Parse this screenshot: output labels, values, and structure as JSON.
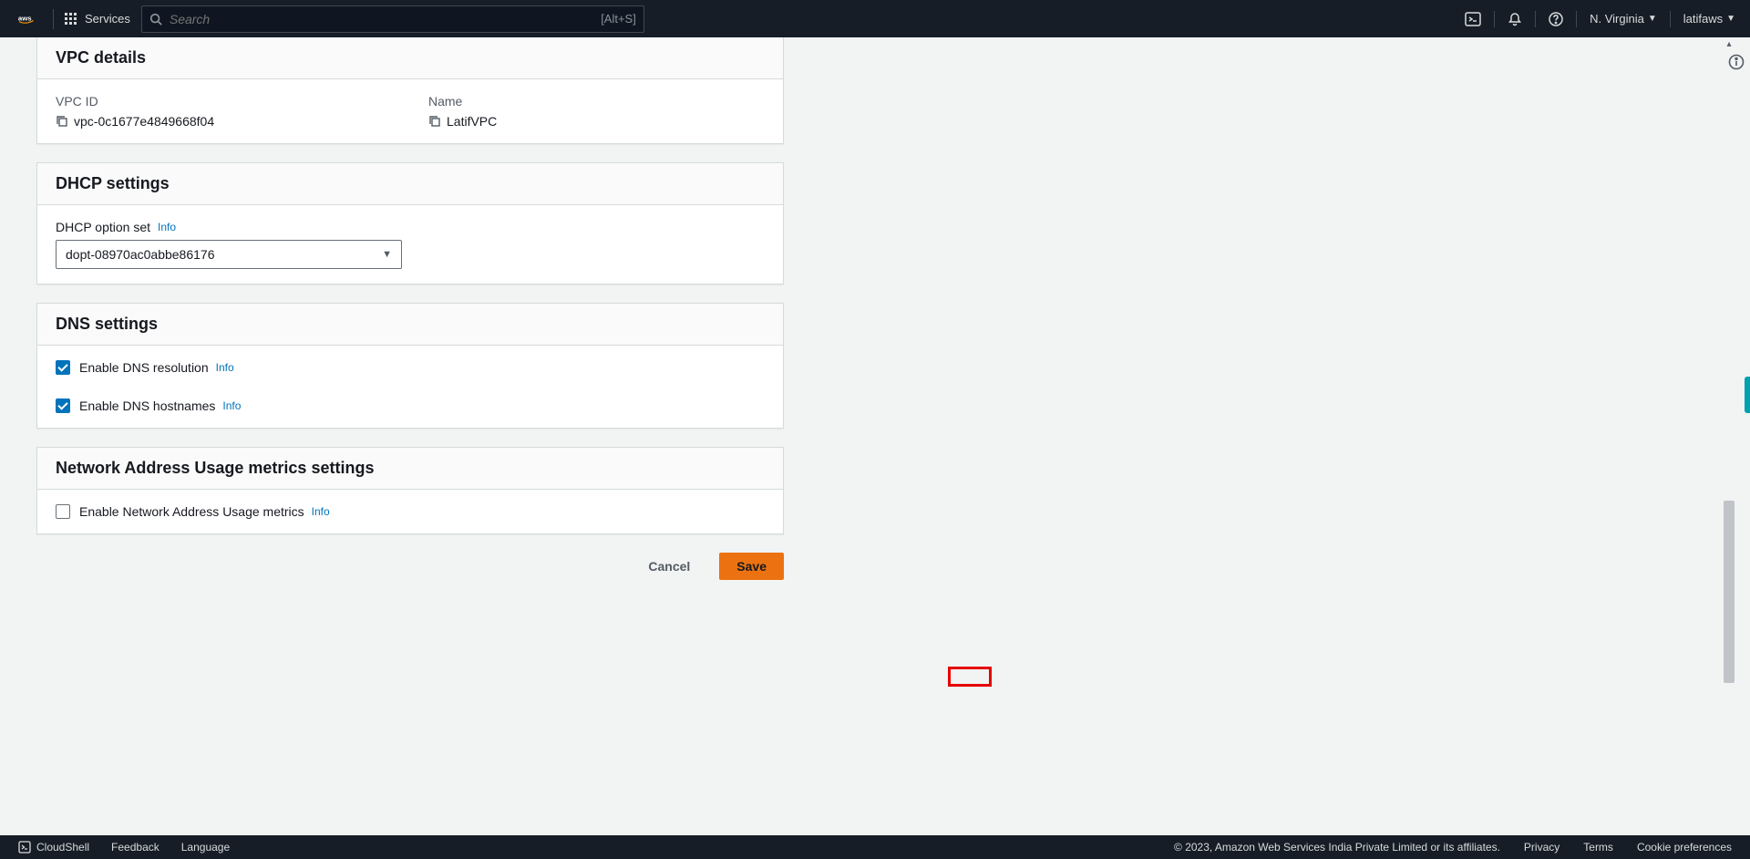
{
  "header": {
    "logo_text": "aws",
    "services_label": "Services",
    "search_placeholder": "Search",
    "search_hint": "[Alt+S]",
    "region": "N. Virginia",
    "account": "latifaws"
  },
  "vpc_details": {
    "title": "VPC details",
    "vpc_id_label": "VPC ID",
    "vpc_id_value": "vpc-0c1677e4849668f04",
    "name_label": "Name",
    "name_value": "LatifVPC"
  },
  "dhcp": {
    "title": "DHCP settings",
    "option_set_label": "DHCP option set",
    "info": "Info",
    "option_set_value": "dopt-08970ac0abbe86176"
  },
  "dns": {
    "title": "DNS settings",
    "enable_resolution_label": "Enable DNS resolution",
    "enable_hostnames_label": "Enable DNS hostnames",
    "info": "Info",
    "resolution_checked": true,
    "hostnames_checked": true
  },
  "nau": {
    "title": "Network Address Usage metrics settings",
    "enable_label": "Enable Network Address Usage metrics",
    "info": "Info",
    "checked": false
  },
  "buttons": {
    "cancel": "Cancel",
    "save": "Save"
  },
  "footer": {
    "cloudshell": "CloudShell",
    "feedback": "Feedback",
    "language": "Language",
    "copyright": "© 2023, Amazon Web Services India Private Limited or its affiliates.",
    "privacy": "Privacy",
    "terms": "Terms",
    "cookies": "Cookie preferences"
  }
}
